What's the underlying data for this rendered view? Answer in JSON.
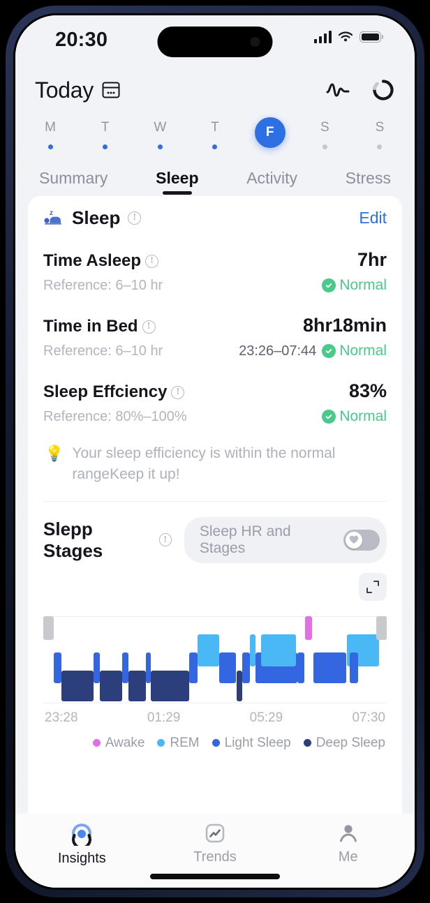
{
  "status_bar": {
    "time": "20:30",
    "signal_icon": "signal-bars-icon",
    "wifi_icon": "wifi-icon",
    "battery_icon": "battery-icon"
  },
  "header": {
    "title": "Today",
    "calendar_icon": "calendar-icon",
    "pulse_icon": "pulse-wave-icon",
    "sync_icon": "sync-ring-icon"
  },
  "week": {
    "days": [
      {
        "letter": "M",
        "selected": false,
        "dot": "active"
      },
      {
        "letter": "T",
        "selected": false,
        "dot": "active"
      },
      {
        "letter": "W",
        "selected": false,
        "dot": "active"
      },
      {
        "letter": "T",
        "selected": false,
        "dot": "active"
      },
      {
        "letter": "F",
        "selected": true,
        "dot": "none"
      },
      {
        "letter": "S",
        "selected": false,
        "dot": "muted"
      },
      {
        "letter": "S",
        "selected": false,
        "dot": "muted"
      }
    ]
  },
  "tabs": [
    {
      "label": "Summary",
      "active": false
    },
    {
      "label": "Sleep",
      "active": true
    },
    {
      "label": "Activity",
      "active": false
    },
    {
      "label": "Stress",
      "active": false
    }
  ],
  "card": {
    "title": "Sleep",
    "sleep_icon": "sleeping-person-icon",
    "info_icon": "info-circle-icon",
    "edit_label": "Edit"
  },
  "metrics": [
    {
      "name": "Time Asleep",
      "value": "7hr",
      "reference": "Reference: 6–10 hr",
      "range": "",
      "status": "Normal"
    },
    {
      "name": "Time in Bed",
      "value": "8hr18min",
      "reference": "Reference: 6–10 hr",
      "range": "23:26–07:44",
      "status": "Normal"
    },
    {
      "name": "Sleep Effciency",
      "value": "83%",
      "reference": "Reference: 80%–100%",
      "range": "",
      "status": "Normal"
    }
  ],
  "tip": {
    "icon": "lightbulb-icon",
    "text": "Your sleep efficiency is within the normal rangeKeep it up!"
  },
  "stages": {
    "title": "Slepp Stages",
    "info_icon": "info-circle-icon",
    "toggle_label": "Sleep HR and Stages",
    "toggle_state": "off",
    "heart_icon": "heart-icon",
    "expand_icon": "expand-icon"
  },
  "chart_data": {
    "type": "bar",
    "title": "Slepp Stages",
    "xlabel": "",
    "ylabel": "",
    "grid": true,
    "legend_position": "bottom-right",
    "x_ticks": [
      "23:28",
      "01:29",
      "05:29",
      "07:30"
    ],
    "x_range": [
      "23:28",
      "07:30"
    ],
    "stage_levels": [
      "Awake",
      "REM",
      "Light Sleep",
      "Deep Sleep"
    ],
    "legend": [
      {
        "label": "Awake",
        "color": "#e06fe8"
      },
      {
        "label": "REM",
        "color": "#4ab8f5"
      },
      {
        "label": "Light Sleep",
        "color": "#3366e0"
      },
      {
        "label": "Deep Sleep",
        "color": "#2c3f7c"
      }
    ],
    "colors": {
      "awake_gray": "#c8cace",
      "awake": "#e06fe8",
      "rem": "#4ab8f5",
      "light": "#3366e0",
      "deep": "#2c3f7c"
    },
    "segments": [
      {
        "stage": "AwakeEdge",
        "start_pct": 0.0,
        "width_pct": 3.0
      },
      {
        "stage": "Light",
        "start_pct": 3.0,
        "width_pct": 2.2
      },
      {
        "stage": "Deep",
        "start_pct": 5.2,
        "width_pct": 9.4
      },
      {
        "stage": "Light",
        "start_pct": 14.6,
        "width_pct": 1.9
      },
      {
        "stage": "Deep",
        "start_pct": 16.5,
        "width_pct": 6.4
      },
      {
        "stage": "Light",
        "start_pct": 22.9,
        "width_pct": 1.9
      },
      {
        "stage": "Deep",
        "start_pct": 24.8,
        "width_pct": 5.0
      },
      {
        "stage": "Light",
        "start_pct": 29.8,
        "width_pct": 1.6
      },
      {
        "stage": "Deep",
        "start_pct": 31.4,
        "width_pct": 11.0
      },
      {
        "stage": "Light",
        "start_pct": 42.4,
        "width_pct": 2.6
      },
      {
        "stage": "REM",
        "start_pct": 45.0,
        "width_pct": 6.2
      },
      {
        "stage": "Light",
        "start_pct": 51.2,
        "width_pct": 5.0
      },
      {
        "stage": "Deep",
        "start_pct": 56.2,
        "width_pct": 1.8
      },
      {
        "stage": "Light",
        "start_pct": 58.0,
        "width_pct": 2.2
      },
      {
        "stage": "REM",
        "start_pct": 60.2,
        "width_pct": 1.5
      },
      {
        "stage": "Light",
        "start_pct": 61.7,
        "width_pct": 12.2
      },
      {
        "stage": "REM",
        "start_pct": 63.5,
        "width_pct": 10.0
      },
      {
        "stage": "Light",
        "start_pct": 73.9,
        "width_pct": 2.2
      },
      {
        "stage": "Awake",
        "start_pct": 76.3,
        "width_pct": 1.9
      },
      {
        "stage": "Light",
        "start_pct": 78.6,
        "width_pct": 9.6
      },
      {
        "stage": "REM",
        "start_pct": 88.4,
        "width_pct": 9.4
      },
      {
        "stage": "Light",
        "start_pct": 89.3,
        "width_pct": 2.4
      },
      {
        "stage": "AwakeEdge",
        "start_pct": 97.0,
        "width_pct": 3.0
      }
    ]
  },
  "bottom_nav": [
    {
      "label": "Insights",
      "icon": "insights-ring-icon",
      "active": true
    },
    {
      "label": "Trends",
      "icon": "trends-chart-icon",
      "active": false
    },
    {
      "label": "Me",
      "icon": "person-icon",
      "active": false
    }
  ]
}
